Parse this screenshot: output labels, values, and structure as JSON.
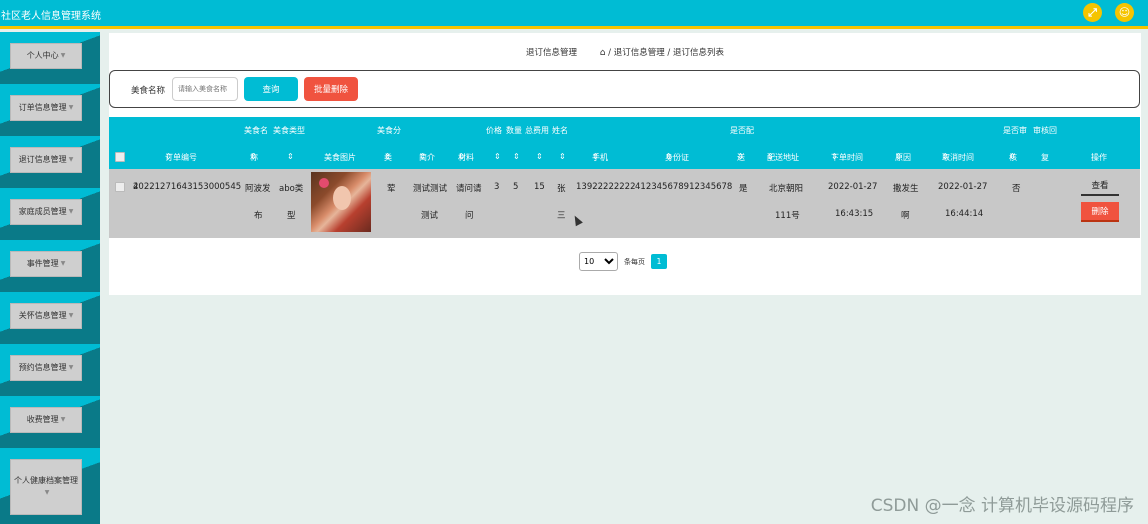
{
  "app": {
    "title": "社区老人信息管理系统"
  },
  "header": {
    "expand_icon": "expand-icon",
    "user_icon": "user-icon",
    "accent": "#00bcd4",
    "highlight": "#f5c400"
  },
  "sidebar": {
    "items": [
      {
        "label": "个人中心"
      },
      {
        "label": "订单信息管理"
      },
      {
        "label": "退订信息管理"
      },
      {
        "label": "家庭成员管理"
      },
      {
        "label": "事件管理"
      },
      {
        "label": "关怀信息管理"
      },
      {
        "label": "预约信息管理"
      },
      {
        "label": "收费管理"
      },
      {
        "label": "个人健康档案管理"
      }
    ],
    "caret": "▼"
  },
  "breadcrumb": {
    "title": "退订信息管理",
    "path1": "退订信息管理",
    "path2": "退订信息列表",
    "sep": "/"
  },
  "search": {
    "label": "美食名称",
    "placeholder": "请输入美食名称",
    "query_button": "查询",
    "batch_delete_button": "批量删除"
  },
  "table": {
    "headers_top": [
      "美食名",
      "美食类型",
      "美食分",
      "价格",
      "数量",
      "总费用",
      "姓名",
      "是否配",
      "是否审",
      "审核回"
    ],
    "headers_bottom": [
      "订单编号",
      "称",
      "",
      "美食图片",
      "类",
      "简介",
      "材料",
      "",
      "",
      "",
      "",
      "手机",
      "身份证",
      "送",
      "配送地址",
      "下单时间",
      "原因",
      "取消时间",
      "核",
      "复",
      "操作"
    ],
    "sort_icon": "⇕",
    "row": {
      "order_no": "20221271643153000545",
      "order_no_tail": "4",
      "food_name_1": "阿波发",
      "food_name_2": "布",
      "food_type_1": "abo类",
      "food_type_2": "型",
      "food_category": "荤",
      "intro_1": "测试测试",
      "intro_2": "测试",
      "material_1": "请问请",
      "material_2": "问",
      "price": "3",
      "qty": "5",
      "total": "15",
      "name_1": "张",
      "name_2": "三",
      "phone": "13922222222",
      "id_card": "412345678912345678",
      "is_delivery": "是",
      "address_1": "北京朝阳",
      "address_2": "111号",
      "order_date": "2022-01-27",
      "order_time": "16:43:15",
      "reason_1": "撒发生",
      "reason_2": "啊",
      "cancel_date": "2022-01-27",
      "cancel_time": "16:44:14",
      "is_audited": "否",
      "view_button": "查看",
      "delete_button": "删除"
    }
  },
  "pagination": {
    "page_size": "10",
    "per_page_label": "条每页",
    "current_page": "1"
  },
  "watermark": "CSDN @一念 计算机毕设源码程序"
}
